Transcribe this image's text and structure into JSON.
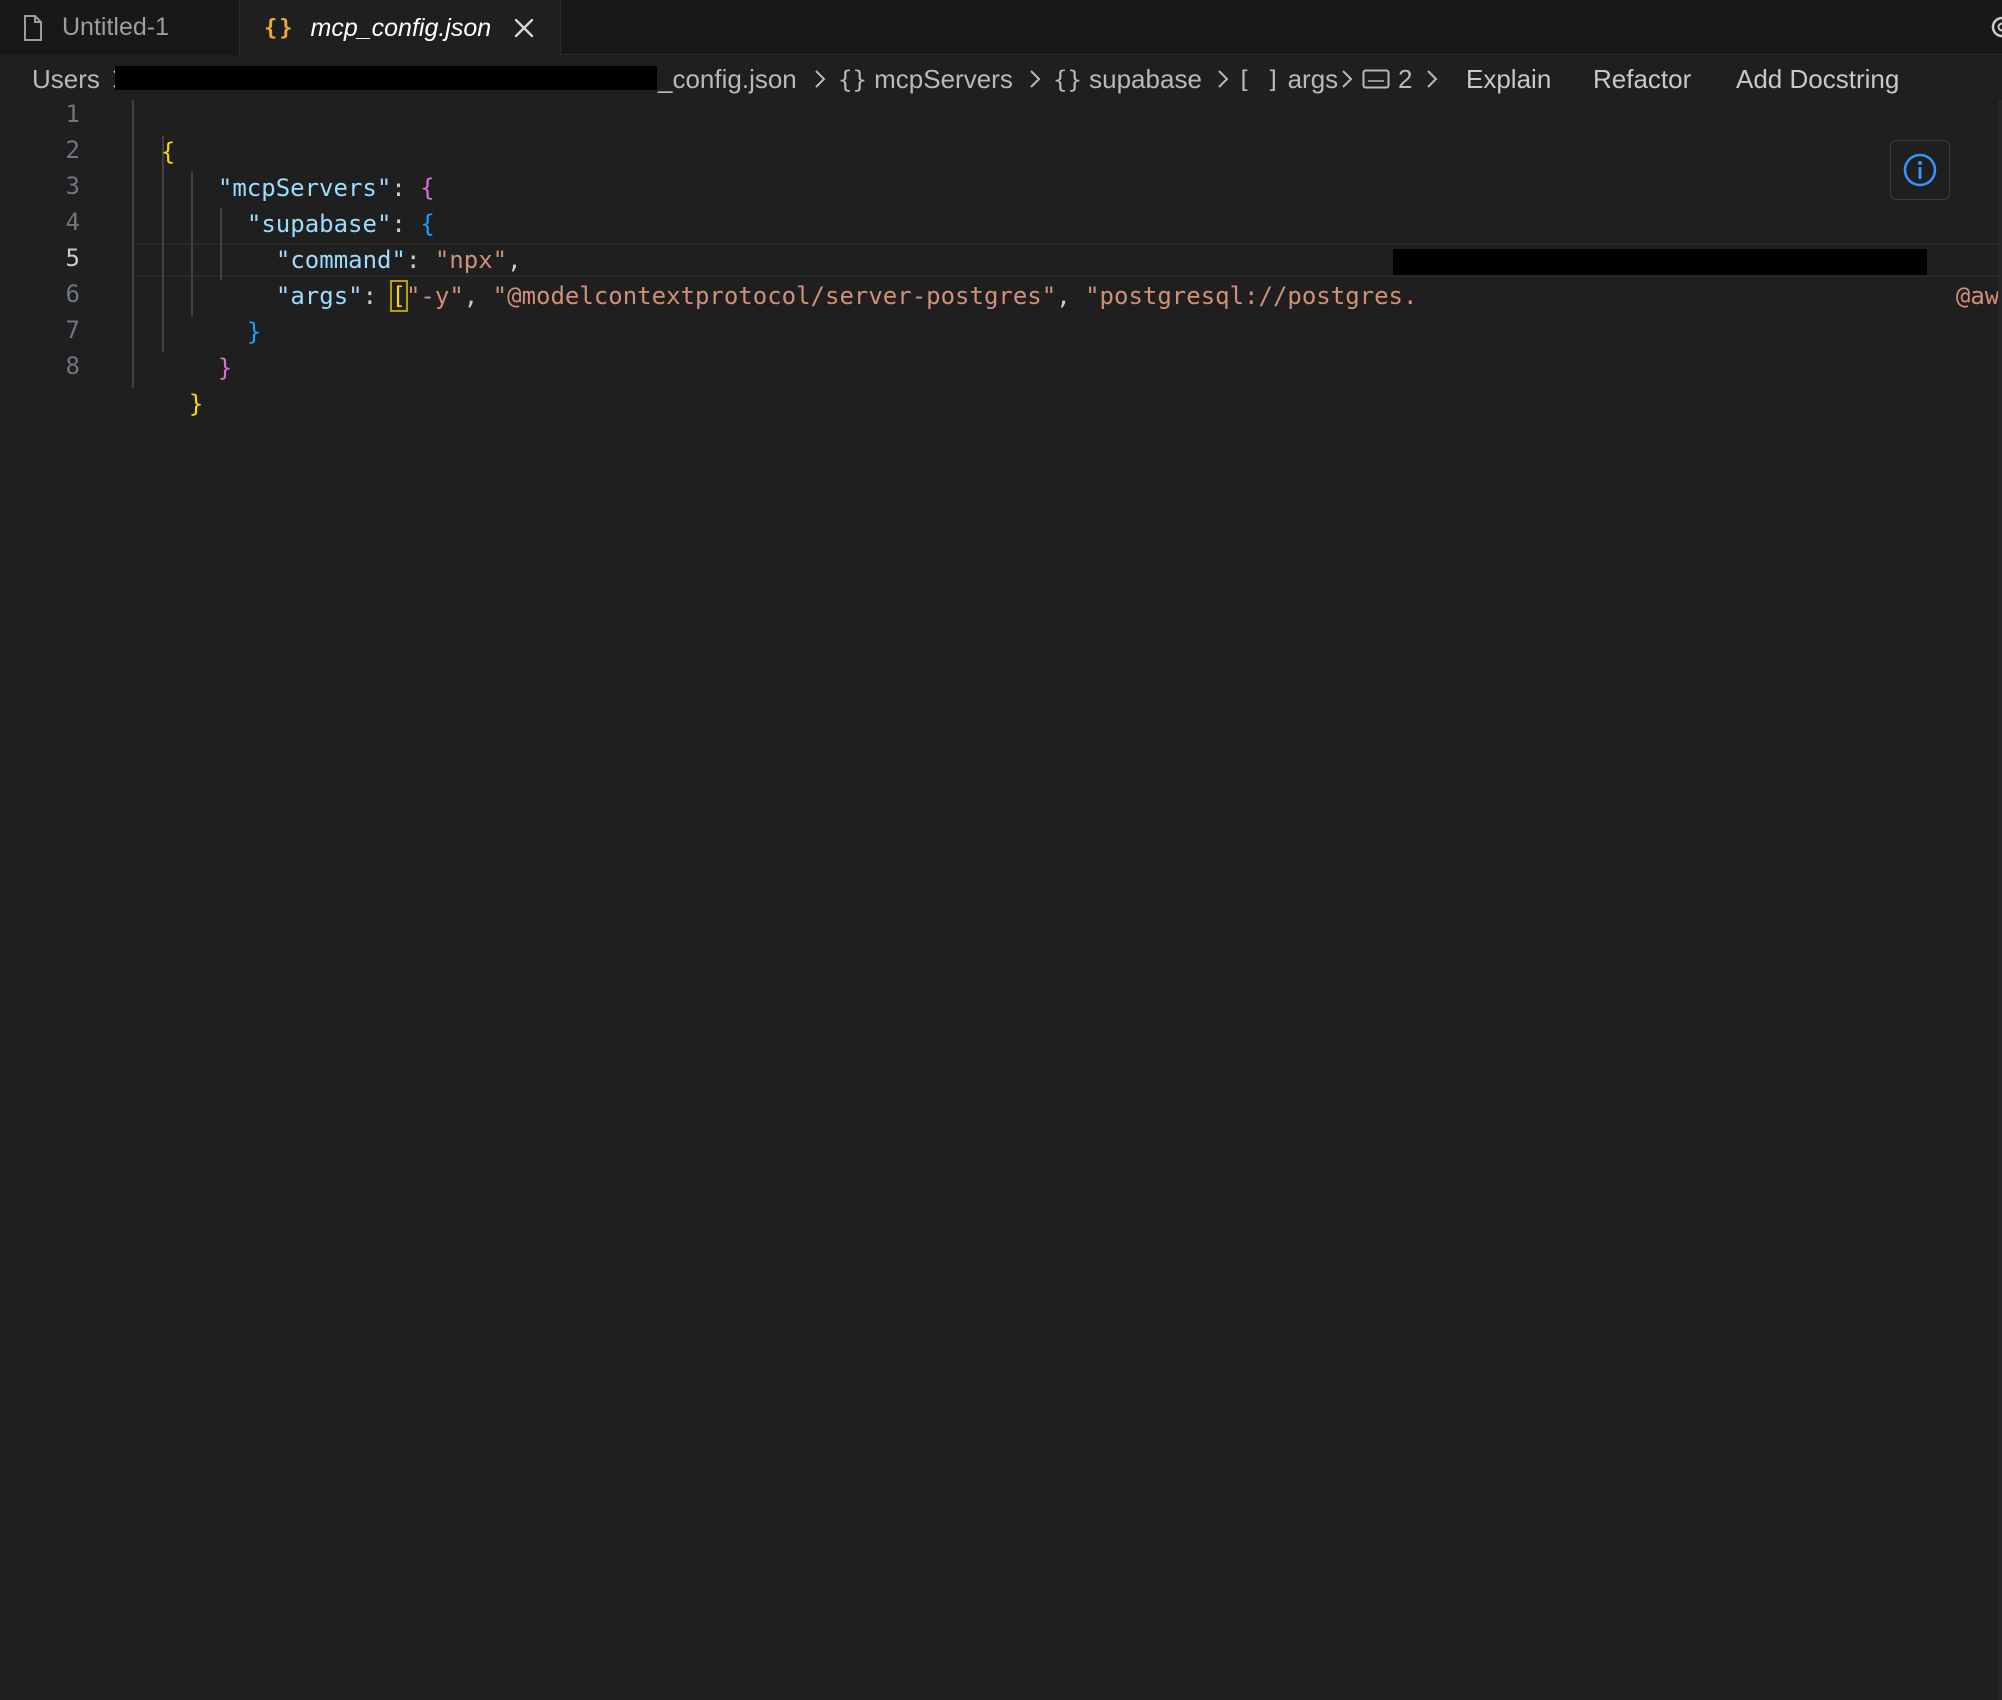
{
  "tabs": [
    {
      "label": "Untitled-1",
      "icon": "file-icon",
      "active": false
    },
    {
      "label": "mcp_config.json",
      "icon": "json-braces-icon",
      "active": true
    }
  ],
  "breadcrumb": {
    "root": "Users",
    "file": "_config.json",
    "items": [
      "mcpServers",
      "supabase",
      "args",
      "2"
    ],
    "object_glyph": "{}",
    "array_glyph": "[ ]",
    "actions": [
      "Explain",
      "Refactor",
      "Add Docstring"
    ]
  },
  "editor": {
    "line_numbers": [
      "1",
      "2",
      "3",
      "4",
      "5",
      "6",
      "7",
      "8"
    ],
    "active_line": "5",
    "code": {
      "l1_open": "{",
      "l2_key": "\"mcpServers\"",
      "l3_key": "\"supabase\"",
      "l4_key": "\"command\"",
      "l4_val": "\"npx\"",
      "l5_key": "\"args\"",
      "l5_arg1": "\"-y\"",
      "l5_arg2": "\"@modelcontextprotocol/server-postgres\"",
      "l5_arg3": "\"postgresql://postgres.",
      "l5_tail": "@aws-",
      "colon": ": ",
      "comma": ", ",
      "open_brace": "{",
      "close_brace": "}",
      "open_bracket": "["
    }
  },
  "colors": {
    "background": "#1f1f1f",
    "key": "#9cdcfe",
    "string": "#ce9178",
    "bracket_level1": "#ffd700",
    "bracket_level2": "#da70d6",
    "bracket_level3": "#179fff",
    "info_accent": "#3794ff"
  }
}
